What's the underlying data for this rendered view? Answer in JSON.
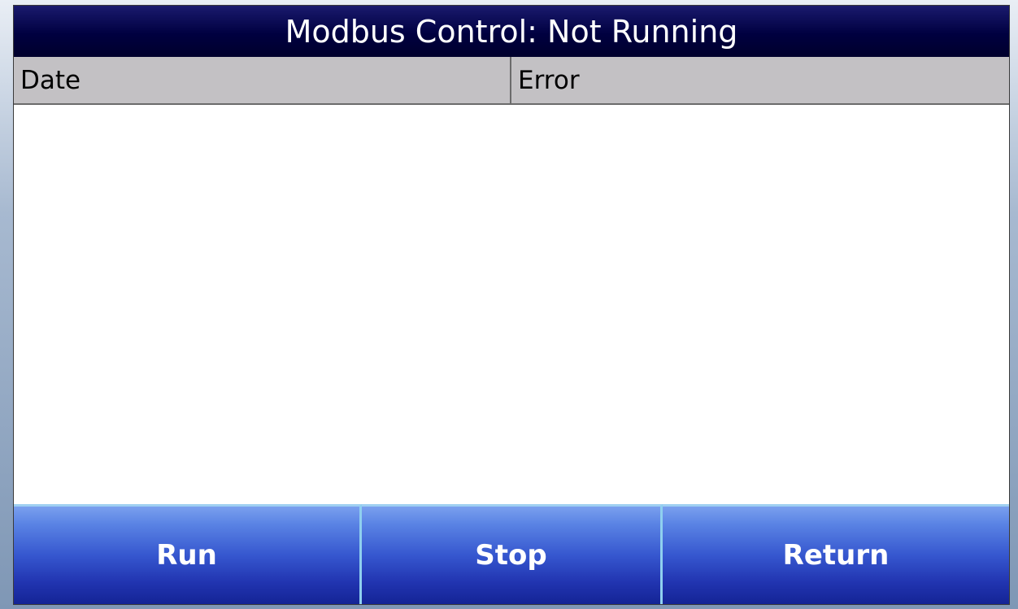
{
  "title": "Modbus Control: Not Running",
  "table": {
    "columns": [
      "Date",
      "Error"
    ],
    "rows": []
  },
  "buttons": {
    "run": "Run",
    "stop": "Stop",
    "return": "Return"
  },
  "colors": {
    "title_bar": "#000040",
    "header_bg": "#c3c1c4",
    "button_blue": "#3657cf",
    "button_divider": "#8fd0ef"
  }
}
